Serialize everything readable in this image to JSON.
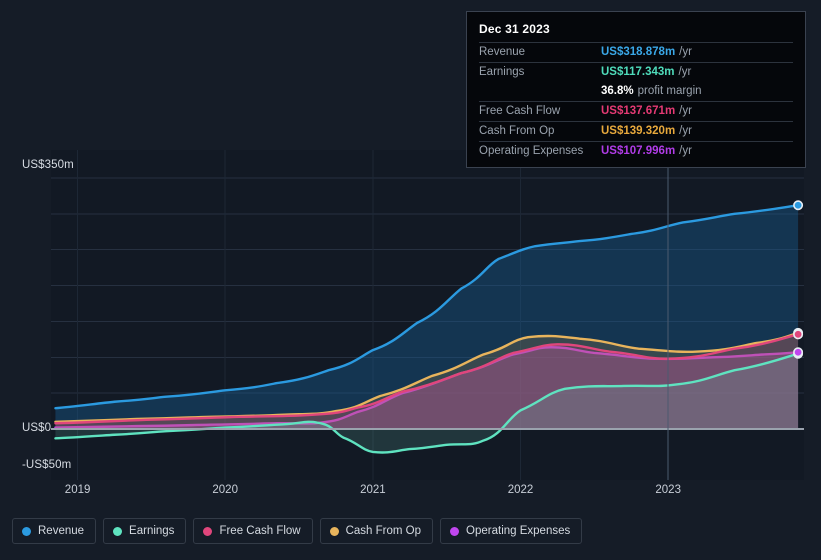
{
  "chart_data": {
    "type": "area",
    "title": "",
    "xlabel": "",
    "ylabel": "",
    "currency": "US$",
    "x_tick_labels": [
      "2019",
      "2020",
      "2021",
      "2022",
      "2023"
    ],
    "x_tick_positions": [
      2019,
      2020,
      2021,
      2022,
      2023
    ],
    "y_tick_labels": [
      "US$350m",
      "US$0",
      "-US$50m"
    ],
    "ylim": [
      -50,
      350
    ],
    "xlim": [
      2018.82,
      2023.92
    ],
    "grid": true,
    "grid_values": [
      350,
      300,
      250,
      200,
      150,
      100,
      50
    ],
    "legend_position": "bottom",
    "zero_line": 0,
    "cursor_x": 2023.0,
    "series": [
      {
        "name": "Revenue",
        "color": "#2b9ae0",
        "fill": "rgba(25,95,150,0.40)",
        "x": [
          2018.85,
          2019.25,
          2019.6,
          2020.0,
          2020.35,
          2020.7,
          2021.0,
          2021.3,
          2021.6,
          2021.85,
          2022.1,
          2022.4,
          2022.75,
          2023.1,
          2023.45,
          2023.88
        ],
        "values": [
          29,
          38,
          45,
          54,
          64,
          82,
          110,
          148,
          196,
          237,
          255,
          262,
          272,
          288,
          300,
          312
        ]
      },
      {
        "name": "Earnings",
        "color": "#5fe3c0",
        "fill": "rgba(110,210,185,0.16)",
        "x": [
          2018.85,
          2019.25,
          2019.6,
          2020.0,
          2020.35,
          2020.62,
          2020.8,
          2021.0,
          2021.25,
          2021.5,
          2021.75,
          2022.0,
          2022.3,
          2022.7,
          2023.05,
          2023.45,
          2023.88
        ],
        "values": [
          -13,
          -8,
          -3,
          2,
          6,
          9,
          -12,
          -32,
          -28,
          -22,
          -16,
          26,
          56,
          60,
          62,
          82,
          105
        ]
      },
      {
        "name": "Free Cash Flow",
        "color": "#e0467c",
        "fill": "rgba(190,70,120,0.22)",
        "x": [
          2018.85,
          2019.5,
          2020.1,
          2020.6,
          2020.9,
          2021.2,
          2021.6,
          2021.95,
          2022.25,
          2022.6,
          2023.0,
          2023.45,
          2023.88
        ],
        "values": [
          8,
          13,
          17,
          20,
          30,
          52,
          78,
          106,
          118,
          108,
          98,
          112,
          132
        ]
      },
      {
        "name": "Cash From Op",
        "color": "#e8b45c",
        "fill": "rgba(185,140,70,0.22)",
        "x": [
          2018.85,
          2019.4,
          2019.9,
          2020.4,
          2020.75,
          2021.05,
          2021.4,
          2021.75,
          2022.05,
          2022.4,
          2022.8,
          2023.2,
          2023.6,
          2023.88
        ],
        "values": [
          10,
          14,
          17,
          20,
          25,
          46,
          74,
          104,
          128,
          126,
          112,
          108,
          120,
          134
        ]
      },
      {
        "name": "Operating Expenses",
        "color": "#c046ef",
        "fill": "rgba(150,90,190,0.34)",
        "x": [
          2018.85,
          2019.4,
          2019.9,
          2020.35,
          2020.65,
          2020.9,
          2021.2,
          2021.6,
          2021.95,
          2022.2,
          2022.5,
          2022.9,
          2023.3,
          2023.65,
          2023.88
        ],
        "values": [
          2,
          4,
          6,
          8,
          9,
          24,
          50,
          78,
          104,
          114,
          106,
          98,
          100,
          104,
          107
        ]
      }
    ]
  },
  "tooltip": {
    "date": "Dec 31 2023",
    "rows": [
      {
        "label": "Revenue",
        "value": "US$318.878m",
        "unit": "/yr",
        "color": "#3aa8e8"
      },
      {
        "label": "Earnings",
        "value": "US$117.343m",
        "unit": "/yr",
        "color": "#4fdcbb"
      },
      {
        "label": "",
        "margin_value": "36.8%",
        "margin_text": "profit margin",
        "color": "#ffffff"
      },
      {
        "label": "Free Cash Flow",
        "value": "US$137.671m",
        "unit": "/yr",
        "color": "#e63a74"
      },
      {
        "label": "Cash From Op",
        "value": "US$139.320m",
        "unit": "/yr",
        "color": "#e8a93c"
      },
      {
        "label": "Operating Expenses",
        "value": "US$107.996m",
        "unit": "/yr",
        "color": "#b13ce8"
      }
    ]
  },
  "legend": {
    "items": [
      {
        "label": "Revenue",
        "color": "#2b9ae0"
      },
      {
        "label": "Earnings",
        "color": "#5fe3c0"
      },
      {
        "label": "Free Cash Flow",
        "color": "#e0467c"
      },
      {
        "label": "Cash From Op",
        "color": "#e8b45c"
      },
      {
        "label": "Operating Expenses",
        "color": "#c046ef"
      }
    ]
  },
  "axis": {
    "y_top": "US$350m",
    "y_zero": "US$0",
    "y_bottom": "-US$50m"
  }
}
